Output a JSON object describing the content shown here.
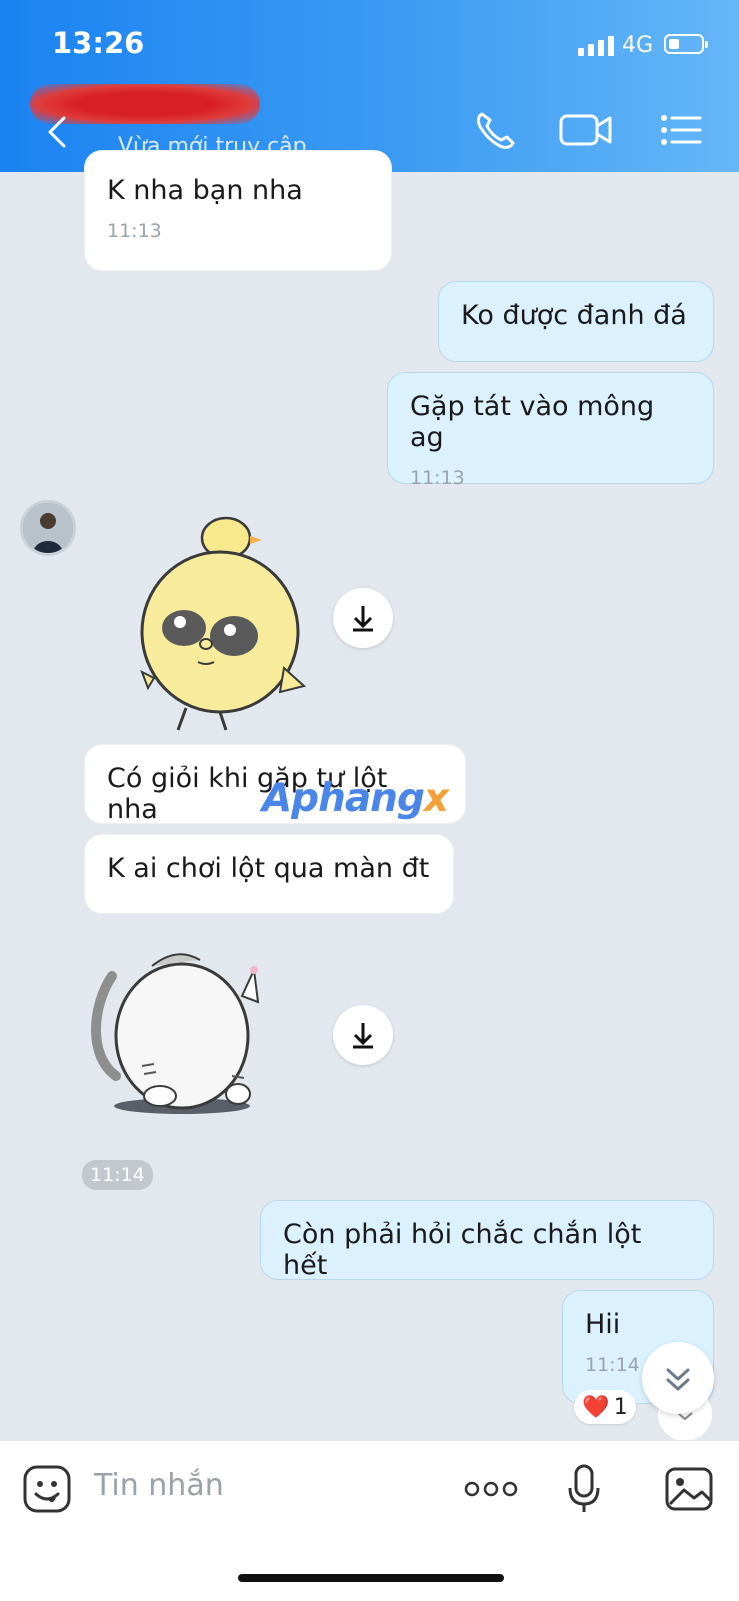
{
  "status_bar": {
    "time": "13:26",
    "network": "4G",
    "battery_level": 0.25
  },
  "header": {
    "contact_status": "Vừa mới truy cập",
    "icons": [
      "back-icon",
      "phone-icon",
      "video-icon",
      "menu-list-icon"
    ]
  },
  "messages": [
    {
      "side": "in",
      "text": "K nha bạn nha",
      "time": "11:13"
    },
    {
      "side": "out",
      "text": "Ko được đanh đá",
      "time": ""
    },
    {
      "side": "out",
      "text": "Gặp tát vào mông ag",
      "time": "11:13"
    },
    {
      "side": "in",
      "type": "sticker",
      "sticker": "yellow-chick-sticker"
    },
    {
      "side": "in",
      "text": "Có giỏi khi gặp tự lột nha",
      "time": ""
    },
    {
      "side": "in",
      "text": "K ai chơi lột qua màn đt",
      "time": ""
    },
    {
      "side": "in",
      "type": "sticker",
      "sticker": "white-cat-sticker",
      "time": "11:14"
    },
    {
      "side": "out",
      "text": "Còn phải hỏi chắc chắn lột hết",
      "time": ""
    },
    {
      "side": "out",
      "text": "Hii",
      "time": "11:14",
      "reaction": {
        "emoji": "❤️",
        "count": "1"
      }
    }
  ],
  "watermark": "Aphangx",
  "composer": {
    "placeholder": "Tin nhắn",
    "icons": [
      "sticker-icon",
      "more-icon",
      "microphone-icon",
      "gallery-icon"
    ]
  },
  "colors": {
    "header": "#1b83f2",
    "outgoing_bubble": "#dcf1fe",
    "incoming_bubble": "#ffffff",
    "background": "#e3e8ef"
  }
}
